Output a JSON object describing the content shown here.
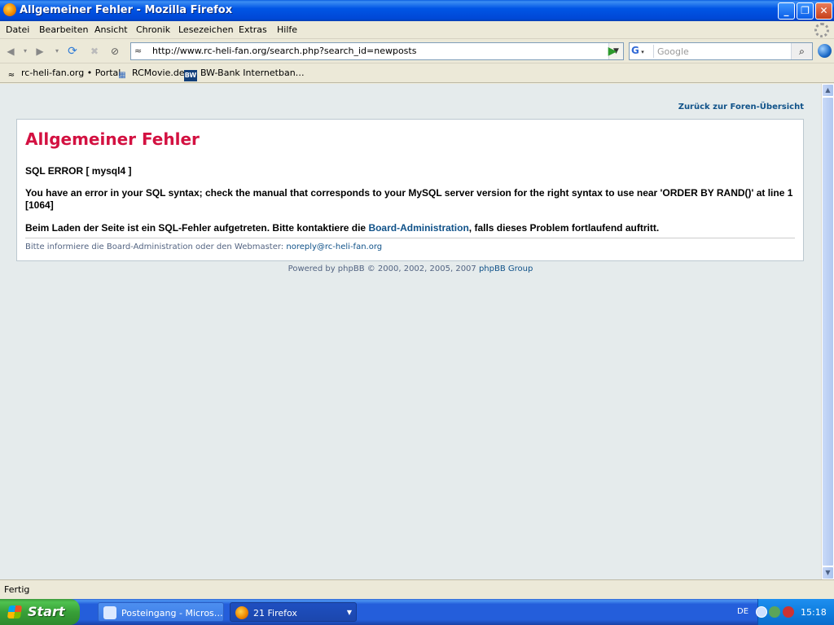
{
  "window": {
    "title": "Allgemeiner Fehler - Mozilla Firefox"
  },
  "menu": [
    "Datei",
    "Bearbeiten",
    "Ansicht",
    "Chronik",
    "Lesezeichen",
    "Extras",
    "Hilfe"
  ],
  "nav": {
    "url": "http://www.rc-heli-fan.org/search.php?search_id=newposts",
    "search_engine": "G",
    "search_placeholder": "Google"
  },
  "bookmarks": [
    {
      "label": "rc-heli-fan.org • Portal",
      "icon": "heli-icon"
    },
    {
      "label": "RCMovie.de",
      "icon": "clapper-icon"
    },
    {
      "label": "BW-Bank Internetban…",
      "icon": "bw-bank-icon",
      "icon_text": "BW"
    }
  ],
  "page": {
    "back_link": "Zurück zur Foren-Übersicht",
    "heading": "Allgemeiner Fehler",
    "sql_error": "SQL ERROR [ mysql4 ]",
    "error_message": "You have an error in your SQL syntax; check the manual that corresponds to your MySQL server version for the right syntax to use near 'ORDER BY RAND()' at line 1",
    "error_code": "[1064]",
    "loading_msg_pre": "Beim Laden der Seite ist ein SQL-Fehler aufgetreten. Bitte kontaktiere die ",
    "loading_msg_link": "Board-Administration",
    "loading_msg_post": ", falls dieses Problem fortlaufend auftritt.",
    "note_pre": "Bitte informiere die Board-Administration oder den Webmaster: ",
    "note_email": "noreply@rc-heli-fan.org",
    "powered_pre": "Powered by phpBB © 2000, 2002, 2005, 2007 ",
    "powered_link": "phpBB Group"
  },
  "status": "Fertig",
  "taskbar": {
    "start": "Start",
    "tasks": [
      {
        "label": "Posteingang - Micros…",
        "icon": "outlook-icon"
      },
      {
        "label": "21 Firefox",
        "icon": "firefox-icon"
      }
    ],
    "lang": "DE",
    "clock": "15:18"
  },
  "colors": {
    "heading": "#d31141",
    "link": "#105289",
    "content_bg": "#e5ebec"
  }
}
